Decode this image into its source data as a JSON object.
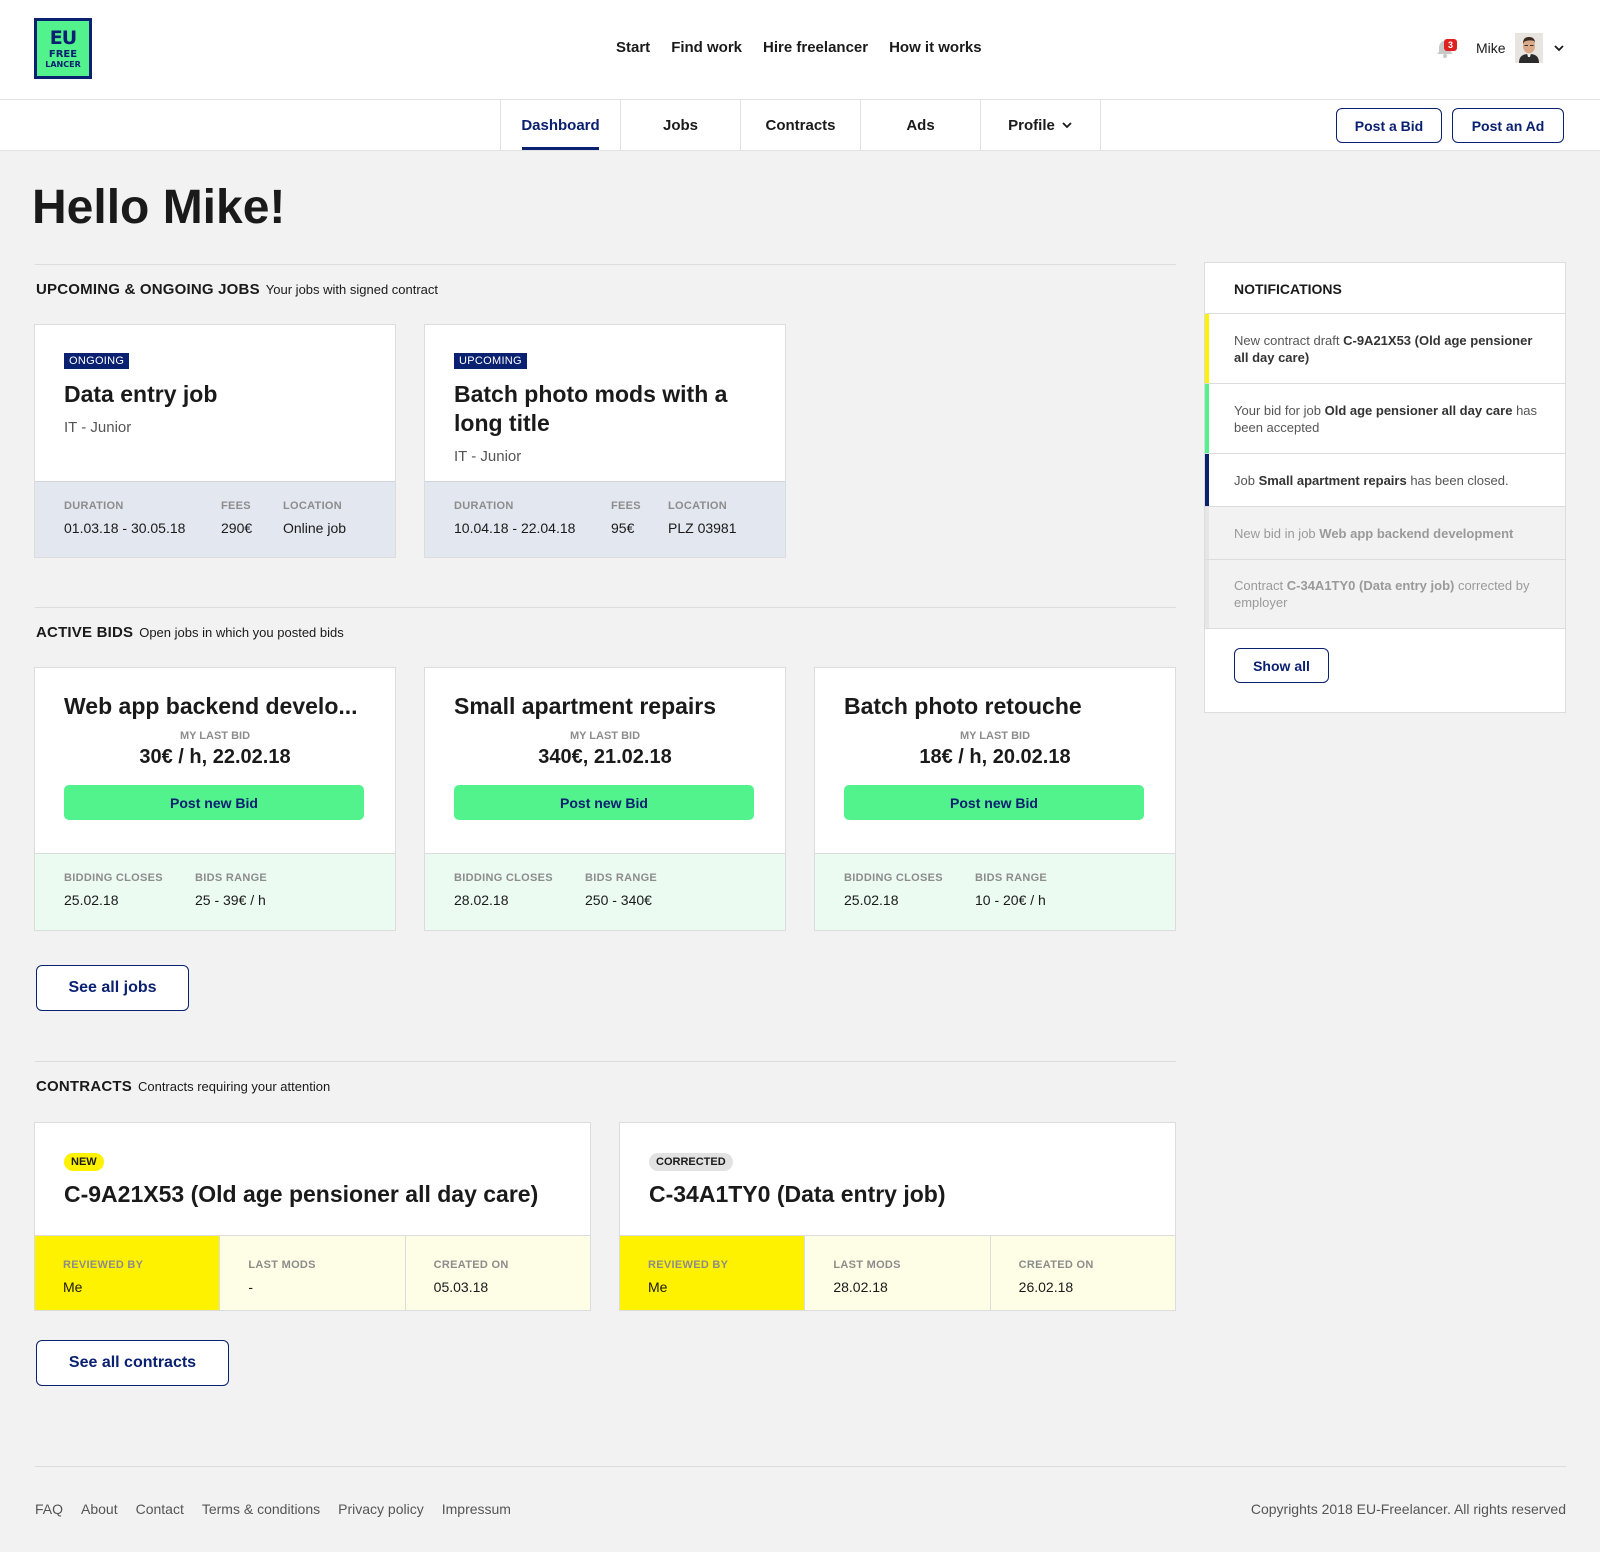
{
  "brand": {
    "logo_line1": "EU",
    "logo_line2": "FREE",
    "logo_line3": "LANCER"
  },
  "topnav": [
    "Start",
    "Find work",
    "Hire freelancer",
    "How it works"
  ],
  "user": {
    "name": "Mike",
    "notification_count": "3"
  },
  "tabs": [
    "Dashboard",
    "Jobs",
    "Contracts",
    "Ads",
    "Profile"
  ],
  "actions": {
    "post_bid": "Post a Bid",
    "post_ad": "Post an Ad"
  },
  "greeting": "Hello Mike!",
  "upcoming": {
    "heading": "UPCOMING & ONGOING JOBS",
    "subheading": "Your jobs with signed contract",
    "labels": {
      "duration": "DURATION",
      "fees": "FEES",
      "location": "LOCATION"
    },
    "jobs": [
      {
        "status": "ONGOING",
        "title": "Data entry job",
        "category": "IT - Junior",
        "duration": "01.03.18 - 30.05.18",
        "fees": "290€",
        "location": "Online job"
      },
      {
        "status": "UPCOMING",
        "title": "Batch photo mods with a long title",
        "category": "IT - Junior",
        "duration": "10.04.18 - 22.04.18",
        "fees": "95€",
        "location": "PLZ 03981"
      }
    ]
  },
  "bids": {
    "heading": "ACTIVE BIDS",
    "subheading": "Open jobs in which you posted bids",
    "labels": {
      "my_last_bid": "MY LAST BID",
      "post_new": "Post new Bid",
      "closes": "BIDDING CLOSES",
      "range": "BIDS RANGE"
    },
    "items": [
      {
        "title": "Web app backend develo...",
        "last_bid": "30€ / h, 22.02.18",
        "closes": "25.02.18",
        "range": "25 - 39€ / h"
      },
      {
        "title": "Small apartment repairs",
        "last_bid": "340€, 21.02.18",
        "closes": "28.02.18",
        "range": "250 - 340€"
      },
      {
        "title": "Batch photo retouche",
        "last_bid": "18€ / h, 20.02.18",
        "closes": "25.02.18",
        "range": "10 - 20€ / h"
      }
    ],
    "see_all": "See all jobs"
  },
  "contracts": {
    "heading": "CONTRACTS",
    "subheading": "Contracts requiring your attention",
    "labels": {
      "reviewed_by": "REVIEWED BY",
      "last_mods": "LAST MODS",
      "created_on": "CREATED ON"
    },
    "items": [
      {
        "badge": "NEW",
        "title": "C-9A21X53 (Old age pensioner all day care)",
        "reviewed_by": "Me",
        "last_mods": "-",
        "created_on": "05.03.18"
      },
      {
        "badge": "CORRECTED",
        "title": "C-34A1TY0 (Data entry job)",
        "reviewed_by": "Me",
        "last_mods": "28.02.18",
        "created_on": "26.02.18"
      }
    ],
    "see_all": "See all contracts"
  },
  "notifications": {
    "heading": "NOTIFICATIONS",
    "items": [
      {
        "pre": "New contract draft ",
        "bold": "C-9A21X53 (Old age pensioner all day care)",
        "post": "",
        "color": "#fff200"
      },
      {
        "pre": "Your bid for job ",
        "bold": "Old age pensioner all day care",
        "post": " has been accepted",
        "color": "#52f28c"
      },
      {
        "pre": "Job ",
        "bold": "Small apartment repairs",
        "post": " has been closed.",
        "color": "#0a2070"
      },
      {
        "pre": "New bid in job ",
        "bold": "Web app backend development",
        "post": ""
      },
      {
        "pre": "Contract ",
        "bold": "C-34A1TY0 (Data entry job)",
        "post": " corrected by employer"
      }
    ],
    "show_all": "Show all"
  },
  "footer": {
    "links": [
      "FAQ",
      "About",
      "Contact",
      "Terms & conditions",
      "Privacy policy",
      "Impressum"
    ],
    "copyright": "Copyrights 2018 EU-Freelancer. All rights reserved"
  },
  "colors": {
    "navy": "#0a2070",
    "green": "#52f28c",
    "yellow": "#fff200"
  }
}
